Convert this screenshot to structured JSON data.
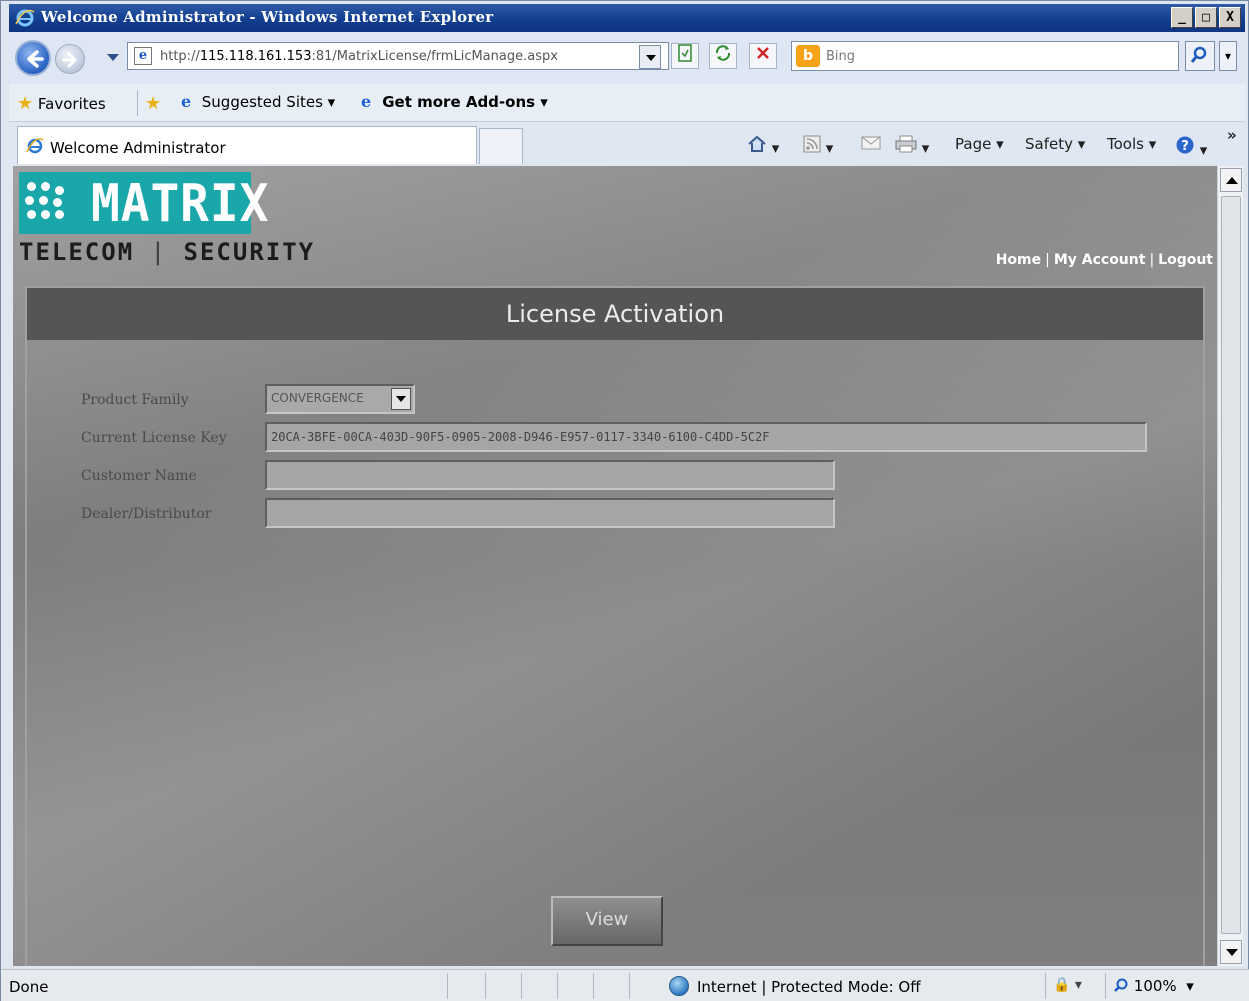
{
  "window": {
    "title": "Welcome Administrator - Windows Internet Explorer",
    "controls": [
      "_",
      "□",
      "X"
    ]
  },
  "address_bar": {
    "url_prefix": "http://",
    "url_host": "115.118.161.153",
    "url_rest": ":81/MatrixLicense/frmLicManage.aspx",
    "search_placeholder": "Bing"
  },
  "favorites_bar": {
    "favorites_label": "Favorites",
    "suggested_sites_label": "Suggested Sites ▾",
    "get_addons_label": "Get more Add-ons ▾"
  },
  "tab": {
    "title": "Welcome Administrator"
  },
  "command_bar": {
    "page_label": "Page ▾",
    "safety_label": "Safety ▾",
    "tools_label": "Tools ▾",
    "more_label": "»"
  },
  "site": {
    "logo_text": "MATRIX",
    "logo_sub_left": "TELECOM",
    "logo_sub_sep": "|",
    "logo_sub_right": "SECURITY",
    "nav": {
      "home": "Home",
      "my_account": "My Account",
      "logout": "Logout",
      "sep": "|"
    }
  },
  "form": {
    "title": "License Activation",
    "product_family_label": "Product Family",
    "product_family_value": "CONVERGENCE",
    "license_key_label": "Current License Key",
    "license_key_value": "20CA-3BFE-00CA-403D-90F5-0905-2008-D946-E957-0117-3340-6100-C4DD-5C2F",
    "customer_name_label": "Customer Name",
    "customer_name_value": "",
    "dealer_label": "Dealer/Distributor",
    "dealer_value": "",
    "view_button": "View"
  },
  "status_bar": {
    "status": "Done",
    "zone": "Internet | Protected Mode: Off",
    "zoom": "100%",
    "security": "▾"
  },
  "colors": {
    "titlebar": "#123e8f",
    "logo_teal": "#1aa7a9",
    "panel_header": "#555555",
    "content_bg": "#858585"
  }
}
